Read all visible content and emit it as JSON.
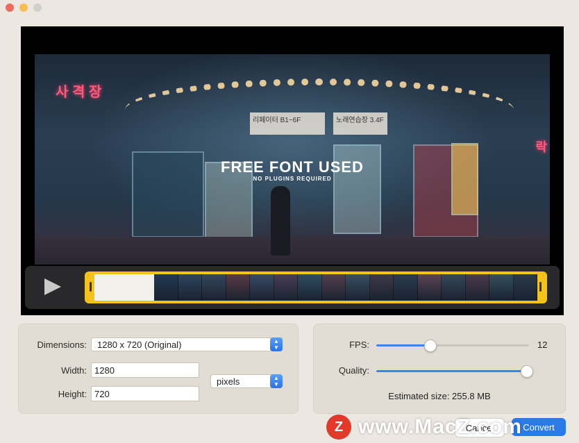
{
  "video": {
    "overlay_title": "FREE FONT USED",
    "overlay_subtitle": "NO PLUGINS REQUIRED",
    "sign_left": "사 격 장",
    "sign_right": "락",
    "board1": "리페이터 B1~6F",
    "board2": "노래연습장 3.4F"
  },
  "settings": {
    "dimensions_label": "Dimensions:",
    "dimensions_value": "1280 x 720 (Original)",
    "width_label": "Width:",
    "width_value": "1280",
    "height_label": "Height:",
    "height_value": "720",
    "unit_value": "pixels",
    "fps_label": "FPS:",
    "fps_value": "12",
    "fps_level": 0.35,
    "quality_label": "Quality:",
    "quality_level": 0.98,
    "estimated_label": "Estimated size: 255.8 MB"
  },
  "watermark": {
    "logo": "Z",
    "text": "www.MacZ.com"
  },
  "buttons": {
    "cancel": "Cancel",
    "convert": "Convert"
  },
  "colors": {
    "accent": "#3a86f0",
    "trim_handle": "#f3c21b"
  },
  "filmstrip_frames": [
    "#203a52",
    "#2c4660",
    "#34485e",
    "#5a3a44",
    "#3a4a66",
    "#4a3e58",
    "#2e4e62",
    "#54404e",
    "#3a5064",
    "#403848",
    "#2a3c50",
    "#5c4452",
    "#36485a",
    "#4c3a4a",
    "#34505e",
    "#2a3a48"
  ]
}
